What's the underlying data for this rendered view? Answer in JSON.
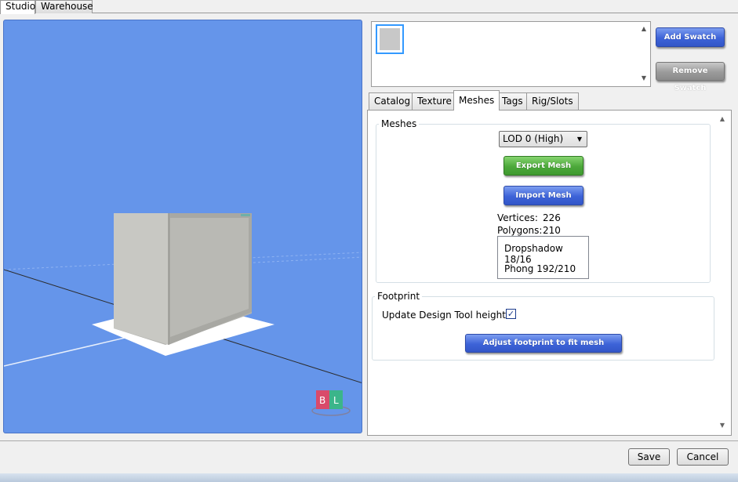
{
  "window_tabs": [
    {
      "label": "Studio",
      "active": true
    },
    {
      "label": "Warehouse",
      "active": false
    }
  ],
  "swatch": {
    "add_label": "Add Swatch",
    "remove_label": "Remove Swatch",
    "selected_color": "#c8c8c8"
  },
  "property_tabs": [
    {
      "label": "Catalog"
    },
    {
      "label": "Texture"
    },
    {
      "label": "Meshes",
      "active": true
    },
    {
      "label": "Tags"
    },
    {
      "label": "Rig/Slots"
    }
  ],
  "meshes": {
    "group_title": "Meshes",
    "lod_selected": "LOD 0 (High)",
    "export_label": "Export Mesh",
    "import_label": "Import Mesh",
    "vertices_label": "Vertices:",
    "vertices_value": "226",
    "polygons_label": "Polygons:",
    "polygons_value": "210",
    "shaders": [
      "Dropshadow 18/16",
      "Phong 192/210"
    ]
  },
  "footprint": {
    "group_title": "Footprint",
    "update_label": "Update Design Tool height",
    "update_checked": true,
    "adjust_label": "Adjust footprint to fit mesh"
  },
  "dialog": {
    "save_label": "Save",
    "cancel_label": "Cancel"
  },
  "colors": {
    "viewport_bg": "#6595ea",
    "accent_blue": "#3d63d8",
    "accent_green": "#4ca83a"
  }
}
